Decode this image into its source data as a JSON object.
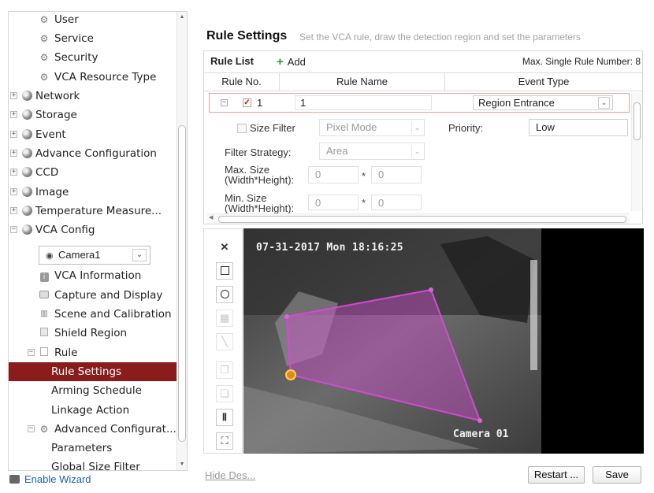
{
  "tree": {
    "items": [
      {
        "label": "User",
        "indent": 2,
        "icon": "gear-icon"
      },
      {
        "label": "Service",
        "indent": 2,
        "icon": "gear-icon"
      },
      {
        "label": "Security",
        "indent": 2,
        "icon": "gear-icon"
      },
      {
        "label": "VCA Resource Type",
        "indent": 2,
        "icon": "gear-icon"
      },
      {
        "label": "Network",
        "indent": 1,
        "icon": "globe-icon",
        "expander": "+"
      },
      {
        "label": "Storage",
        "indent": 1,
        "icon": "globe-icon",
        "expander": "+"
      },
      {
        "label": "Event",
        "indent": 1,
        "icon": "globe-icon",
        "expander": "+"
      },
      {
        "label": "Advance Configuration",
        "indent": 1,
        "icon": "globe-icon",
        "expander": "+"
      },
      {
        "label": "CCD",
        "indent": 1,
        "icon": "globe-icon",
        "expander": "+"
      },
      {
        "label": "Image",
        "indent": 1,
        "icon": "globe-icon",
        "expander": "+"
      },
      {
        "label": "Temperature Measure...",
        "indent": 1,
        "icon": "globe-icon",
        "expander": "+"
      },
      {
        "label": "VCA Config",
        "indent": 1,
        "icon": "globe-icon",
        "expander": "−"
      },
      {
        "label": "",
        "indent": 2,
        "icon": "",
        "camera_select": true
      },
      {
        "label": "VCA Information",
        "indent": 2,
        "icon": "info-icon"
      },
      {
        "label": "Capture and Display",
        "indent": 2,
        "icon": "camera-icon"
      },
      {
        "label": "Scene and Calibration",
        "indent": 2,
        "icon": "scene-icon"
      },
      {
        "label": "Shield Region",
        "indent": 2,
        "icon": "shield-region-icon"
      },
      {
        "label": "Rule",
        "indent": 2,
        "icon": "rule-icon",
        "expander": "−"
      },
      {
        "label": "Rule Settings",
        "indent": 3,
        "icon": "",
        "selected": true
      },
      {
        "label": "Arming Schedule",
        "indent": 3,
        "icon": ""
      },
      {
        "label": "Linkage Action",
        "indent": 3,
        "icon": ""
      },
      {
        "label": "Advanced Configurat...",
        "indent": 2,
        "icon": "gear-icon",
        "expander": "−"
      },
      {
        "label": "Parameters",
        "indent": 3,
        "icon": ""
      },
      {
        "label": "Global Size Filter",
        "indent": 3,
        "icon": ""
      }
    ],
    "camera_select_value": "Camera1"
  },
  "footer": {
    "wizard_label": "Enable Wizard",
    "hide_des_label": "Hide Des...",
    "restart_label": "Restart ...",
    "save_label": "Save"
  },
  "rule_settings": {
    "title": "Rule Settings",
    "subtitle": "Set the VCA rule, draw the detection region and set the parameters",
    "rule_list_label": "Rule List",
    "add_label": "Add",
    "max_rules_label": "Max. Single Rule Number: 8",
    "columns": [
      "Rule No.",
      "Rule Name",
      "Event Type"
    ],
    "rule": {
      "expander": "−",
      "checked": true,
      "number": "1",
      "name": "1",
      "event_type": "Region Entrance"
    },
    "size_filter_label": "Size Filter",
    "size_filter_mode": "Pixel Mode",
    "priority_label": "Priority:",
    "priority_value": "Low",
    "filter_strategy_label": "Filter Strategy:",
    "filter_strategy_value": "Area",
    "max_size_label_1": "Max. Size",
    "max_size_label_2": "(Width*Height):",
    "max_w": "0",
    "max_h": "0",
    "min_size_label_1": "Min. Size",
    "min_size_label_2": "(Width*Height):",
    "min_w": "0",
    "min_h": "0",
    "times_sign": "*"
  },
  "video": {
    "osd_time": "07-31-2017 Mon 18:16:25",
    "osd_camera": "Camera 01",
    "region_color": "#d24bd2"
  },
  "colors": {
    "selected_bg": "#8a1c1c",
    "link": "#1a5fb4",
    "add_plus": "#2e9d2e"
  }
}
